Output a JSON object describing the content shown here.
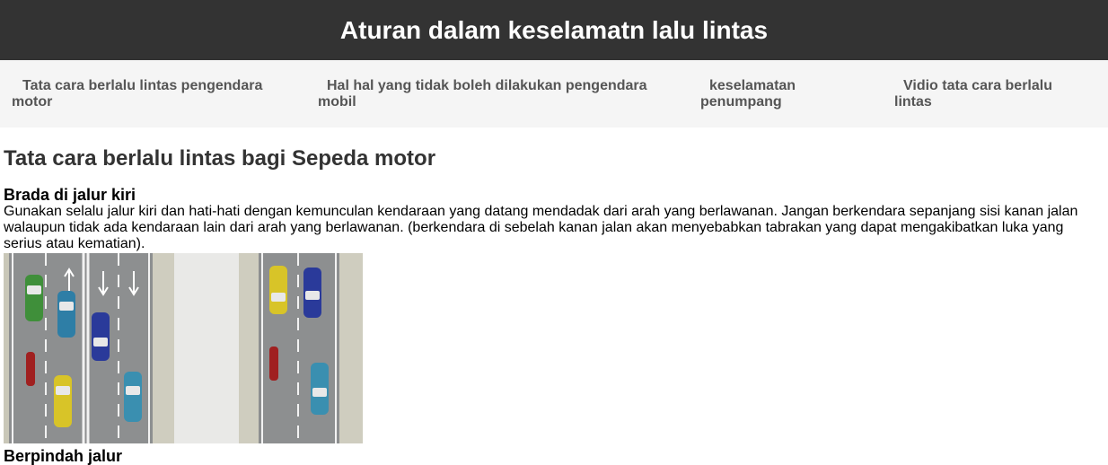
{
  "header": {
    "title": "Aturan dalam keselamatn lalu lintas"
  },
  "nav": {
    "items": [
      {
        "label": "Tata cara berlalu lintas pengendara motor"
      },
      {
        "label": "Hal hal yang tidak boleh dilakukan pengendara mobil"
      },
      {
        "label": "keselamatan penumpang"
      },
      {
        "label": "Vidio tata cara berlalu lintas"
      }
    ]
  },
  "main": {
    "title": "Tata cara berlalu lintas bagi Sepeda motor",
    "sections": [
      {
        "heading": "Brada di jalur kiri",
        "text": "Gunakan selalu jalur kiri dan hati-hati dengan kemunculan kendaraan yang datang mendadak dari arah yang berlawanan. Jangan berkendara sepanjang sisi kanan jalan walaupun tidak ada kendaraan lain dari arah yang berlawanan. (berkendara di sebelah kanan jalan akan menyebabkan tabrakan yang dapat mengakibatkan luka yang serius atau kematian)."
      },
      {
        "heading": "Berpindah jalur"
      }
    ]
  },
  "colors": {
    "header_bg": "#333333",
    "nav_bg": "#f5f5f5",
    "nav_text": "#555555"
  }
}
